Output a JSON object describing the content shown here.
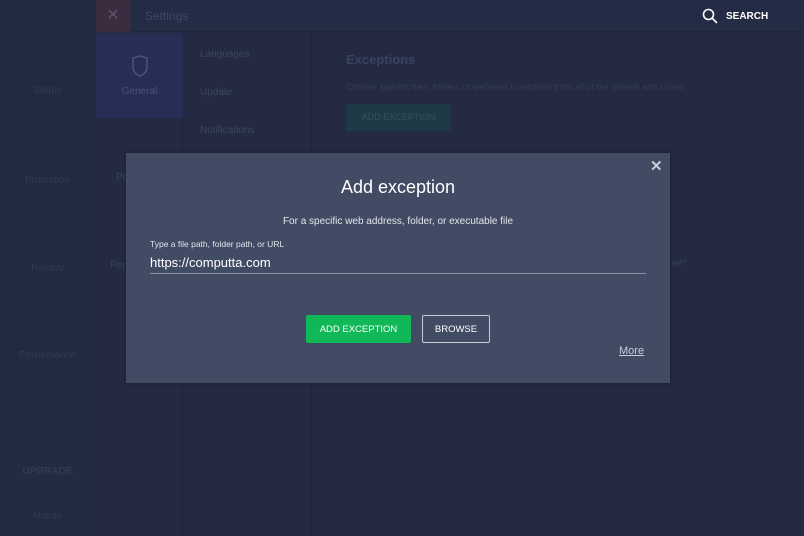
{
  "sidebar": {
    "items": [
      {
        "label": "Status"
      },
      {
        "label": "Protection"
      },
      {
        "label": "Privacy"
      },
      {
        "label": "Performance"
      }
    ],
    "upgrade": "UPGRADE",
    "mobile": "Mobile"
  },
  "header": {
    "title": "Settings",
    "search_label": "SEARCH"
  },
  "categories": [
    {
      "label": "General",
      "selected": true
    },
    {
      "label": "Pr"
    },
    {
      "label": "Per"
    }
  ],
  "submenu": [
    {
      "label": "Languages"
    },
    {
      "label": "Update"
    },
    {
      "label": "Notifications"
    }
  ],
  "content": {
    "title": "Exceptions",
    "description": "Choose specific files, folders or websites to exclude from all of our shields and scans.",
    "add_button": "ADD EXCEPTION",
    "partial_path": "er\\*"
  },
  "dialog": {
    "title": "Add exception",
    "subtitle": "For a specific web address, folder, or executable file",
    "field_label": "Type a file path, folder path, or URL",
    "field_value": "https://computta.com",
    "add_button": "ADD EXCEPTION",
    "browse_button": "BROWSE",
    "more_link": "More"
  },
  "colors": {
    "accent": "#11b857",
    "dialog_bg": "#414b64",
    "page_bg": "#232a42"
  }
}
